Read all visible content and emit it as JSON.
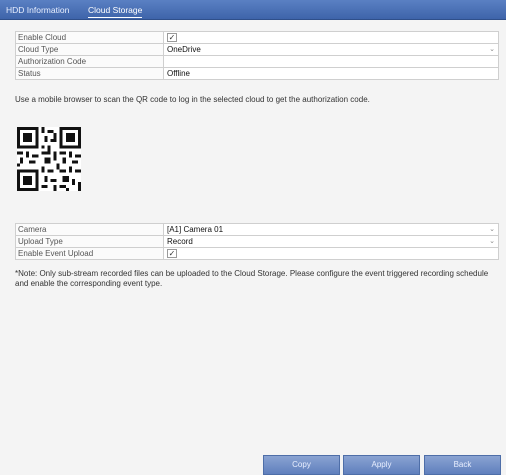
{
  "tabs": [
    {
      "label": "HDD Information",
      "active": false
    },
    {
      "label": "Cloud Storage",
      "active": true
    }
  ],
  "cloud": {
    "enable_cloud": {
      "label": "Enable Cloud",
      "checked": true
    },
    "cloud_type": {
      "label": "Cloud Type",
      "value": "OneDrive"
    },
    "authorization_code": {
      "label": "Authorization Code",
      "value": ""
    },
    "status": {
      "label": "Status",
      "value": "Offline"
    }
  },
  "qr_instruction": "Use a mobile browser to scan the QR code to log in the selected cloud to get the authorization code.",
  "upload": {
    "camera": {
      "label": "Camera",
      "value": "[A1] Camera 01"
    },
    "upload_type": {
      "label": "Upload Type",
      "value": "Record"
    },
    "enable_event_upload": {
      "label": "Enable Event Upload",
      "checked": true
    }
  },
  "note": "*Note: Only sub-stream recorded files can be uploaded to the Cloud Storage. Please configure the event triggered recording schedule and enable the corresponding event type.",
  "buttons": {
    "copy": "Copy",
    "apply": "Apply",
    "back": "Back"
  },
  "colors": {
    "tab_bar": "#4a70b6",
    "button": "#6f8cc6"
  },
  "icons": {
    "checkbox": "check-icon",
    "dropdown": "chevron-down-icon",
    "qr": "qr-code"
  }
}
